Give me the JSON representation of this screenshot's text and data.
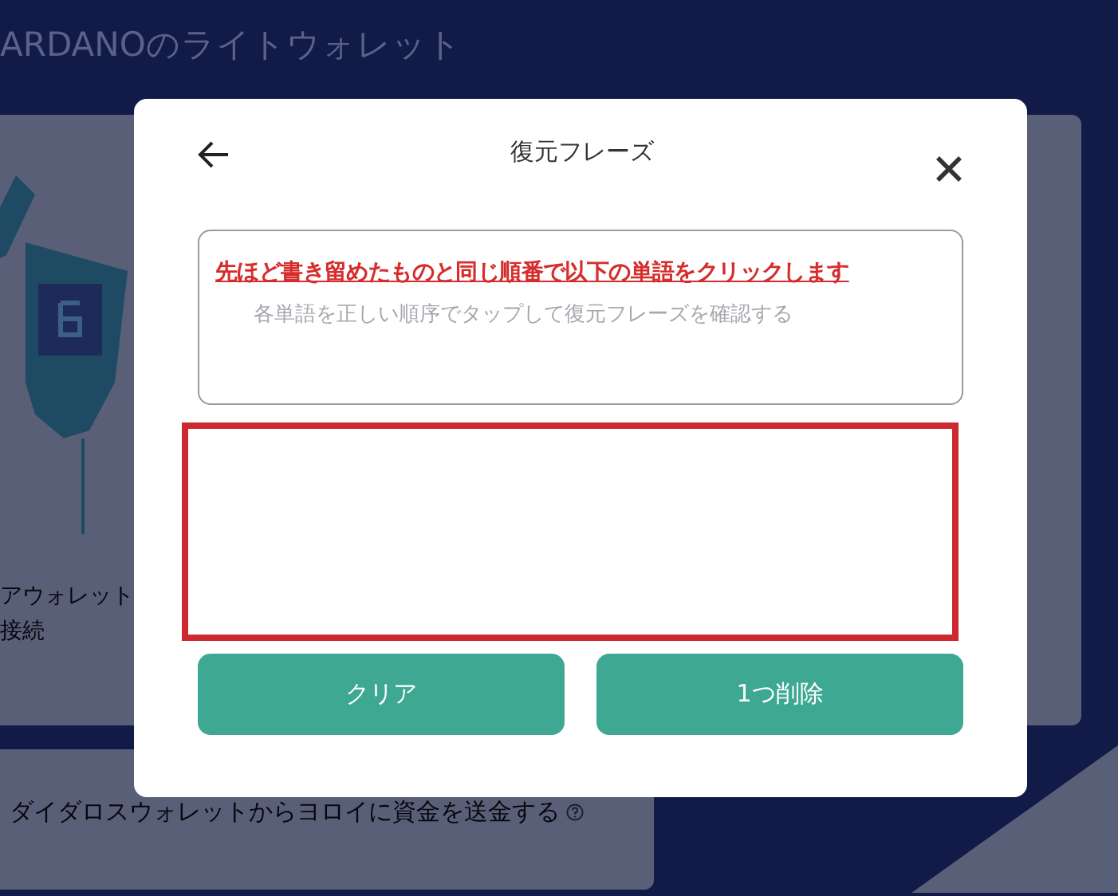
{
  "background": {
    "heading": "ARDANOのライトウォレット",
    "hardware_card": {
      "lines": [
        "アウォレット",
        "接続"
      ]
    },
    "transfer_card": {
      "text": "ダイダロスウォレットからヨロイに資金を送金する"
    }
  },
  "dialog": {
    "title": "復元フレーズ",
    "instruction": "先ほど書き留めたものと同じ順番で以下の単語をクリックします",
    "hint": "各単語を正しい順序でタップして復元フレーズを確認する",
    "word_area": {
      "highlighted": true
    },
    "buttons": [
      {
        "label": "クリア",
        "disabled": true
      },
      {
        "label": "1つ削除",
        "disabled": true
      }
    ]
  }
}
